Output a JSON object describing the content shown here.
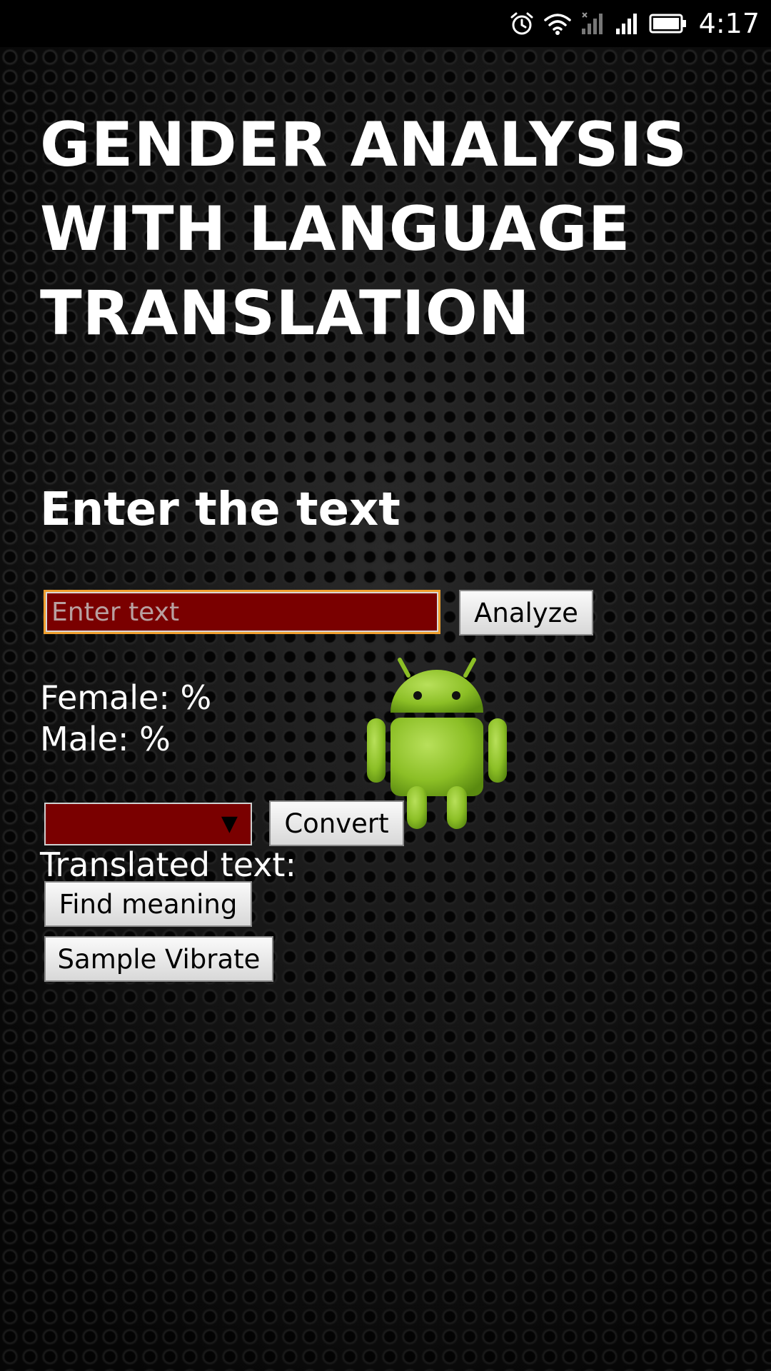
{
  "status_bar": {
    "time": "4:17",
    "icons": [
      "alarm-icon",
      "wifi-icon",
      "signal-sim1-icon",
      "signal-sim2-icon",
      "battery-icon"
    ]
  },
  "app": {
    "title": "GENDER ANALYSIS WITH LANGUAGE TRANSLATION",
    "section_heading": "Enter the text"
  },
  "input": {
    "value": "",
    "placeholder": "Enter text"
  },
  "buttons": {
    "analyze": "Analyze",
    "convert": "Convert",
    "find_meaning": "Find meaning",
    "sample_vibrate": "Sample Vibrate"
  },
  "results": {
    "female": "Female: %",
    "male": "Male: %",
    "translated_label": "Translated text:"
  },
  "language_select": {
    "selected": "",
    "arrow": "▼"
  },
  "colors": {
    "field_background": "#7a0000",
    "focus_border": "#f0a030",
    "android_green": "#8cbf26"
  },
  "decoration": {
    "mascot": "android-mascot-icon"
  }
}
